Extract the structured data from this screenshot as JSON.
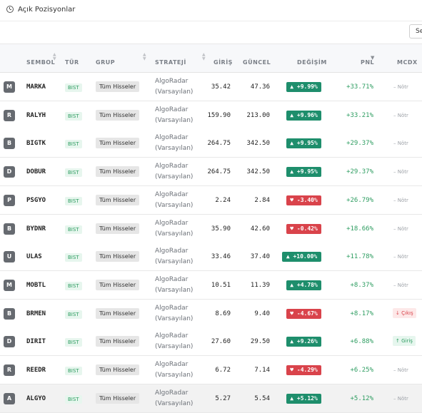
{
  "header": {
    "title": "Açık Pozisyonlar",
    "icon": "clock-icon"
  },
  "filter": {
    "search_label": "Se"
  },
  "columns": {
    "sembol": "SEMBOL",
    "tur": "TÜR",
    "grup": "GRUP",
    "strateji": "STRATEJİ",
    "giris": "GİRİŞ",
    "guncel": "GÜNCEL",
    "degisim": "DEĞİŞİM",
    "pnl": "PNL",
    "mcdx": "MCDX"
  },
  "colors": {
    "up": "#1e8e6c",
    "down": "#d9434b",
    "pnl_positive": "#2e9d61"
  },
  "rows": [
    {
      "initial": "M",
      "symbol": "MARKA",
      "type": "BIST",
      "group": "Tüm Hisseler",
      "strategy_1": "AlgoRadar",
      "strategy_2": "(Varsayılan)",
      "entry": "35.42",
      "current": "47.36",
      "change": "+9.99%",
      "dir": "up",
      "pnl": "+33.71%",
      "mcdx": "Nötr",
      "mcdx_type": "notr"
    },
    {
      "initial": "R",
      "symbol": "RALYH",
      "type": "BIST",
      "group": "Tüm Hisseler",
      "strategy_1": "AlgoRadar",
      "strategy_2": "(Varsayılan)",
      "entry": "159.90",
      "current": "213.00",
      "change": "+9.96%",
      "dir": "up",
      "pnl": "+33.21%",
      "mcdx": "Nötr",
      "mcdx_type": "notr"
    },
    {
      "initial": "B",
      "symbol": "BIGTK",
      "type": "BIST",
      "group": "Tüm Hisseler",
      "strategy_1": "AlgoRadar",
      "strategy_2": "(Varsayılan)",
      "entry": "264.75",
      "current": "342.50",
      "change": "+9.95%",
      "dir": "up",
      "pnl": "+29.37%",
      "mcdx": "Nötr",
      "mcdx_type": "notr"
    },
    {
      "initial": "D",
      "symbol": "DOBUR",
      "type": "BIST",
      "group": "Tüm Hisseler",
      "strategy_1": "AlgoRadar",
      "strategy_2": "(Varsayılan)",
      "entry": "264.75",
      "current": "342.50",
      "change": "+9.95%",
      "dir": "up",
      "pnl": "+29.37%",
      "mcdx": "Nötr",
      "mcdx_type": "notr"
    },
    {
      "initial": "P",
      "symbol": "PSGYO",
      "type": "BIST",
      "group": "Tüm Hisseler",
      "strategy_1": "AlgoRadar",
      "strategy_2": "(Varsayılan)",
      "entry": "2.24",
      "current": "2.84",
      "change": "-3.40%",
      "dir": "down",
      "pnl": "+26.79%",
      "mcdx": "Nötr",
      "mcdx_type": "notr"
    },
    {
      "initial": "B",
      "symbol": "BYDNR",
      "type": "BIST",
      "group": "Tüm Hisseler",
      "strategy_1": "AlgoRadar",
      "strategy_2": "(Varsayılan)",
      "entry": "35.90",
      "current": "42.60",
      "change": "-0.42%",
      "dir": "down",
      "pnl": "+18.66%",
      "mcdx": "Nötr",
      "mcdx_type": "notr"
    },
    {
      "initial": "U",
      "symbol": "ULAS",
      "type": "BIST",
      "group": "Tüm Hisseler",
      "strategy_1": "AlgoRadar",
      "strategy_2": "(Varsayılan)",
      "entry": "33.46",
      "current": "37.40",
      "change": "+10.00%",
      "dir": "up",
      "pnl": "+11.78%",
      "mcdx": "Nötr",
      "mcdx_type": "notr"
    },
    {
      "initial": "M",
      "symbol": "MOBTL",
      "type": "BIST",
      "group": "Tüm Hisseler",
      "strategy_1": "AlgoRadar",
      "strategy_2": "(Varsayılan)",
      "entry": "10.51",
      "current": "11.39",
      "change": "+4.78%",
      "dir": "up",
      "pnl": "+8.37%",
      "mcdx": "Nötr",
      "mcdx_type": "notr"
    },
    {
      "initial": "B",
      "symbol": "BRMEN",
      "type": "BIST",
      "group": "Tüm Hisseler",
      "strategy_1": "AlgoRadar",
      "strategy_2": "(Varsayılan)",
      "entry": "8.69",
      "current": "9.40",
      "change": "-4.67%",
      "dir": "down",
      "pnl": "+8.17%",
      "mcdx": "Çıkış",
      "mcdx_type": "cikis"
    },
    {
      "initial": "D",
      "symbol": "DIRIT",
      "type": "BIST",
      "group": "Tüm Hisseler",
      "strategy_1": "AlgoRadar",
      "strategy_2": "(Varsayılan)",
      "entry": "27.60",
      "current": "29.50",
      "change": "+9.26%",
      "dir": "up",
      "pnl": "+6.88%",
      "mcdx": "Giriş",
      "mcdx_type": "giris"
    },
    {
      "initial": "R",
      "symbol": "REEDR",
      "type": "BIST",
      "group": "Tüm Hisseler",
      "strategy_1": "AlgoRadar",
      "strategy_2": "(Varsayılan)",
      "entry": "6.72",
      "current": "7.14",
      "change": "-4.29%",
      "dir": "down",
      "pnl": "+6.25%",
      "mcdx": "Nötr",
      "mcdx_type": "notr"
    },
    {
      "initial": "A",
      "symbol": "ALGYO",
      "type": "BIST",
      "group": "Tüm Hisseler",
      "strategy_1": "AlgoRadar",
      "strategy_2": "(Varsayılan)",
      "entry": "5.27",
      "current": "5.54",
      "change": "+5.12%",
      "dir": "up",
      "pnl": "+5.12%",
      "mcdx": "Nötr",
      "mcdx_type": "notr",
      "highlighted": true
    }
  ]
}
